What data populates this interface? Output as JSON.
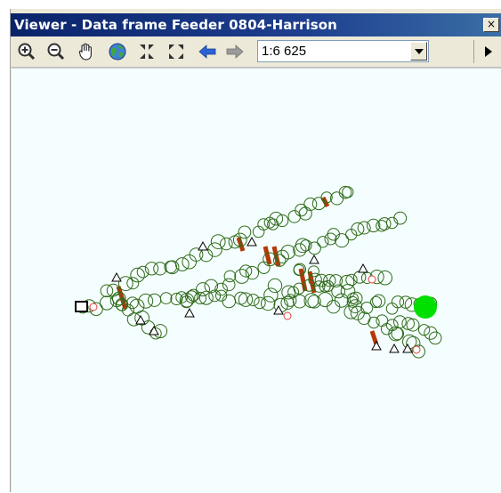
{
  "window": {
    "title": "Viewer - Data frame Feeder 0804-Harrison",
    "close_label": "×"
  },
  "toolbar": {
    "tools": [
      {
        "name": "zoom-in-icon"
      },
      {
        "name": "zoom-out-icon"
      },
      {
        "name": "pan-hand-icon"
      },
      {
        "name": "globe-full-extent-icon"
      },
      {
        "name": "fixed-zoom-in-icon"
      },
      {
        "name": "fixed-zoom-out-icon"
      },
      {
        "name": "back-arrow-icon"
      },
      {
        "name": "forward-arrow-icon"
      }
    ],
    "scale_value": "1:6 625",
    "play_icon": "triangle-right-icon"
  },
  "map": {
    "background": "#f5fefe",
    "feature_colors": {
      "circle_stroke": "#2f6b1a",
      "line": "#b23a0a",
      "source_point": "#00e000",
      "red_marker": "#e04040"
    }
  }
}
